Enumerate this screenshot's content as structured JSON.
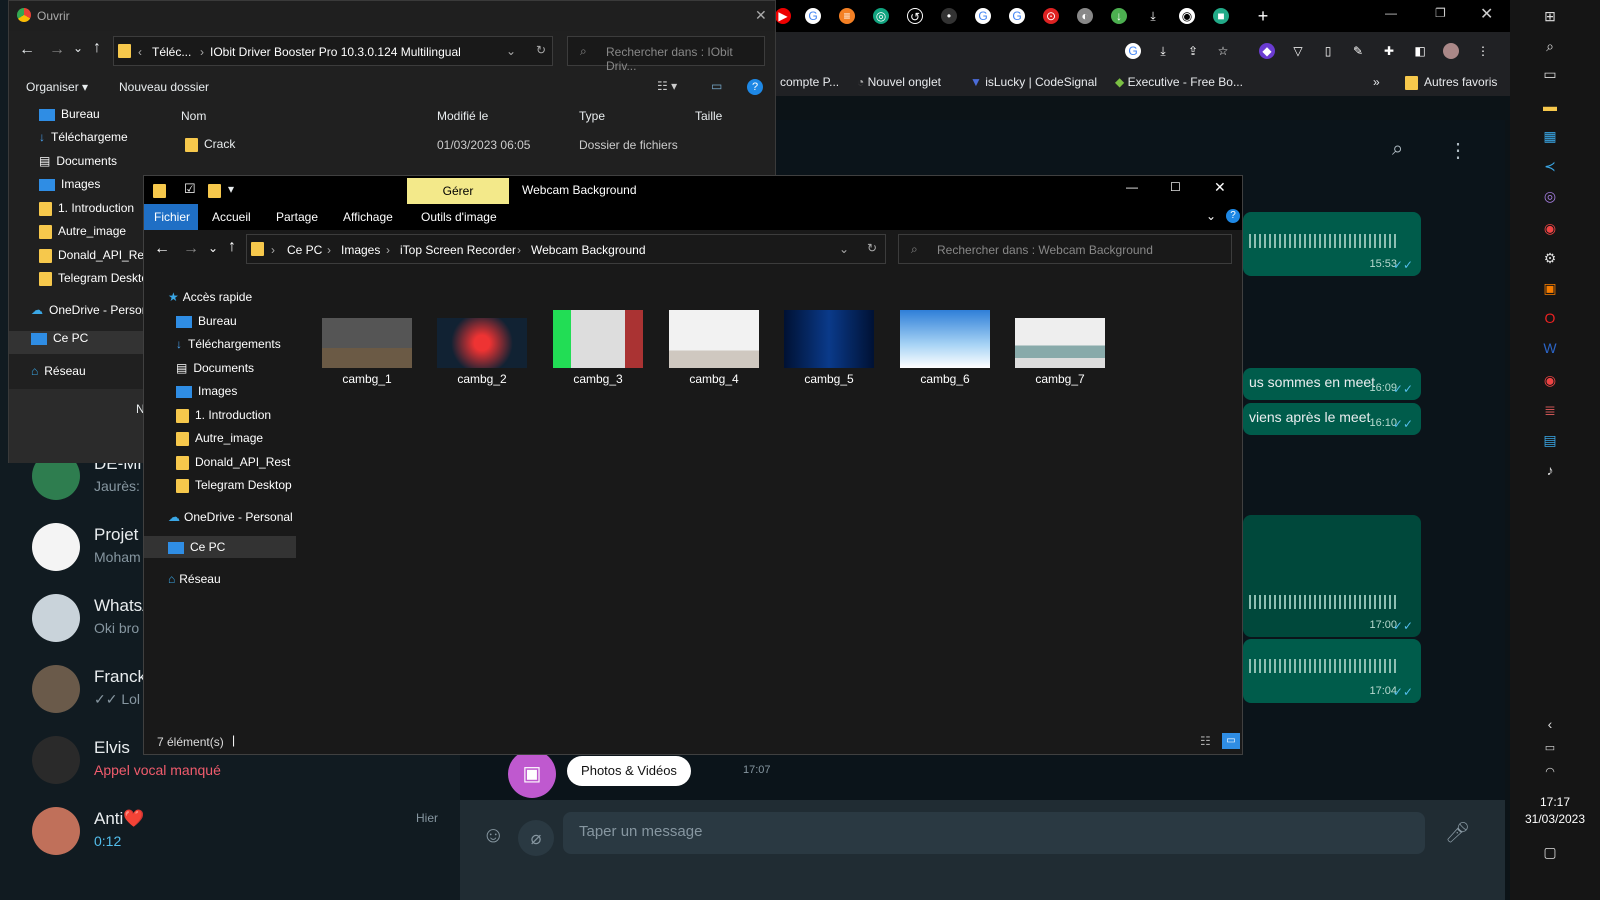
{
  "chrome": {
    "bookmarks": [
      "compte P...",
      "Nouvel onglet",
      "isLucky | CodeSignal",
      "Executive - Free Bo...",
      "»",
      "Autres favoris"
    ]
  },
  "whatsapp": {
    "chats": [
      {
        "name": "DE-Mi",
        "preview": "Jaurès:",
        "time": ""
      },
      {
        "name": "Projet",
        "preview": "Moham",
        "time": ""
      },
      {
        "name": "WhatsA",
        "preview": "Oki bro",
        "time": ""
      },
      {
        "name": "Franck",
        "preview": "✓✓ Lol je",
        "time": ""
      },
      {
        "name": "Elvis",
        "preview": "Appel vocal manqué",
        "time": ""
      },
      {
        "name": "Anti❤️",
        "preview": "0:12",
        "time": "Hier"
      }
    ],
    "messages": [
      {
        "text": "",
        "time": "15:53"
      },
      {
        "text": "us sommes en meet",
        "time": "16:09"
      },
      {
        "text": "viens après le meet",
        "time": "16:10"
      },
      {
        "text": "",
        "time": "17:00"
      },
      {
        "text": "",
        "time": "17:04"
      }
    ],
    "attach_label": "Photos & Vidéos",
    "attach_time": "17:07",
    "input_placeholder": "Taper un message"
  },
  "dialog": {
    "title": "Ouvrir",
    "path_prefix": "Téléc...",
    "path_current": "IObit Driver Booster Pro 10.3.0.124 Multilingual",
    "search_placeholder": "Rechercher dans : IObit Driv...",
    "organize": "Organiser",
    "new_folder": "Nouveau dossier",
    "columns": [
      "Nom",
      "Modifié le",
      "Type",
      "Taille"
    ],
    "rows": [
      {
        "name": "Crack",
        "modified": "01/03/2023 06:05",
        "type": "Dossier de fichiers"
      }
    ],
    "nav": [
      "Bureau",
      "Téléchargeme",
      "Documents",
      "Images",
      "1. Introduction",
      "Autre_image",
      "Donald_API_Res",
      "Telegram Deskto",
      "OneDrive - Persor",
      "Ce PC",
      "Réseau"
    ],
    "footer_fragment": "N"
  },
  "explorer": {
    "manage_tab": "Gérer",
    "title": "Webcam Background",
    "ribbon": [
      "Fichier",
      "Accueil",
      "Partage",
      "Affichage",
      "Outils d'image"
    ],
    "breadcrumb": [
      "Ce PC",
      "Images",
      "iTop Screen Recorder",
      "Webcam Background"
    ],
    "search_placeholder": "Rechercher dans : Webcam Background",
    "nav": [
      "Accès rapide",
      "Bureau",
      "Téléchargements",
      "Documents",
      "Images",
      "1. Introduction",
      "Autre_image",
      "Donald_API_Rest",
      "Telegram Desktop",
      "OneDrive - Personal",
      "Ce PC",
      "Réseau"
    ],
    "files": [
      "cambg_1",
      "cambg_2",
      "cambg_3",
      "cambg_4",
      "cambg_5",
      "cambg_6",
      "cambg_7"
    ],
    "status": "7 élément(s)"
  },
  "taskbar": {
    "time": "17:17",
    "date": "31/03/2023"
  },
  "colors": {
    "wa_bubble": "#005c4b",
    "explorer_bg": "#191919",
    "manage_tab": "#f3e98a",
    "folder": "#f6c84c"
  }
}
